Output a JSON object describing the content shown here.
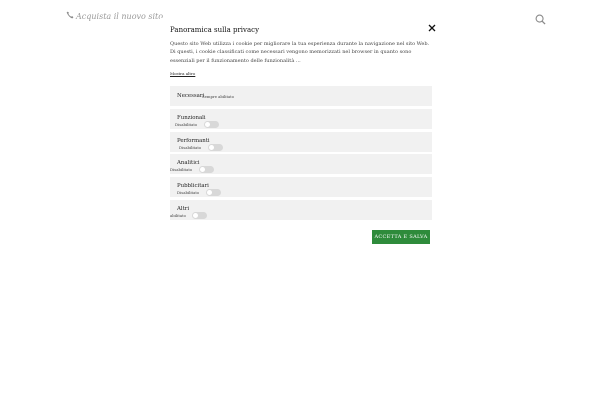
{
  "background": {
    "phone_icon": "phone-icon",
    "phone_link": "Acquista il nuovo sito",
    "search_icon": "search-icon"
  },
  "modal": {
    "title": "Panoramica sulla privacy",
    "close_icon": "close-icon",
    "description": "Questo sito Web utilizza i cookie per migliorare la tua esperienza durante la navigazione nel sito Web. Di questi, i cookie classificati come necessari vengono memorizzati nel browser in quanto sono essenziali per il funzionamento delle funzionalità ...",
    "show_more": "Mostra altro",
    "categories": [
      {
        "label": "Necessari",
        "status": "Sempre abilitato"
      },
      {
        "label": "Funzionali",
        "status": "Disabilitato",
        "enabled": false
      },
      {
        "label": "Performanti",
        "status": "Disabilitato",
        "enabled": false
      },
      {
        "label": "Analitici",
        "status": "Disabilitato",
        "enabled": false
      },
      {
        "label": "Pubblicitari",
        "status": "Disabilitato",
        "enabled": false
      },
      {
        "label": "Altri",
        "status": "abilitato",
        "enabled": false
      }
    ],
    "save_button": "ACCETTA E SALVA",
    "accent_color": "#2e8b3b"
  }
}
